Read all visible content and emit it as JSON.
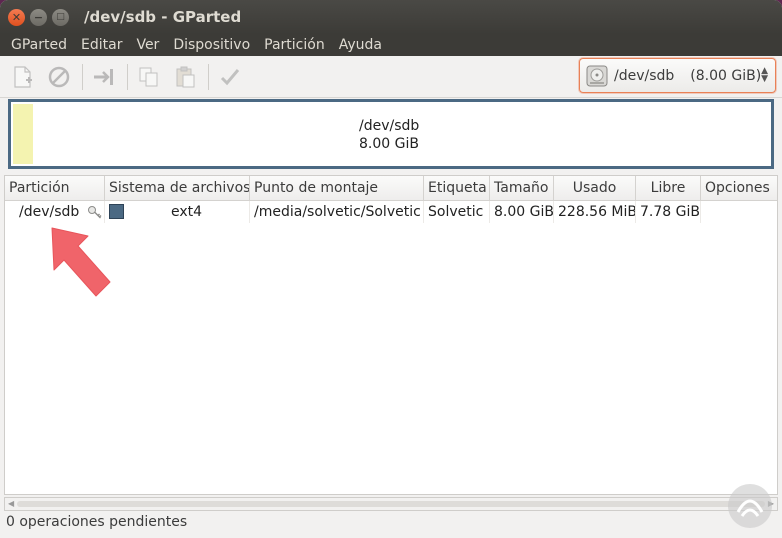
{
  "window": {
    "title": "/dev/sdb - GParted"
  },
  "menu": [
    "GParted",
    "Editar",
    "Ver",
    "Dispositivo",
    "Partición",
    "Ayuda"
  ],
  "toolbar": {
    "buttons": [
      "new-icon",
      "delete-icon",
      "resize-move-icon",
      "copy-icon",
      "paste-icon",
      "apply-icon"
    ],
    "device": {
      "name": "/dev/sdb",
      "size": "(8.00 GiB)"
    }
  },
  "diskmap": {
    "device": "/dev/sdb",
    "size": "8.00 GiB"
  },
  "table": {
    "columns": [
      "Partición",
      "Sistema de archivos",
      "Punto de montaje",
      "Etiqueta",
      "Tamaño",
      "Usado",
      "Libre",
      "Opciones"
    ],
    "rows": [
      {
        "partition": "/dev/sdb",
        "filesystem": "ext4",
        "mountpoint": "/media/solvetic/Solvetic",
        "label": "Solvetic",
        "size": "8.00 GiB",
        "used": "228.56 MiB",
        "free": "7.78 GiB",
        "flags": ""
      }
    ]
  },
  "status": {
    "text": "0 operaciones pendientes"
  },
  "colors": {
    "ext4": "#4b6983",
    "accent": "#e95420",
    "pointer": "#f0646a"
  }
}
